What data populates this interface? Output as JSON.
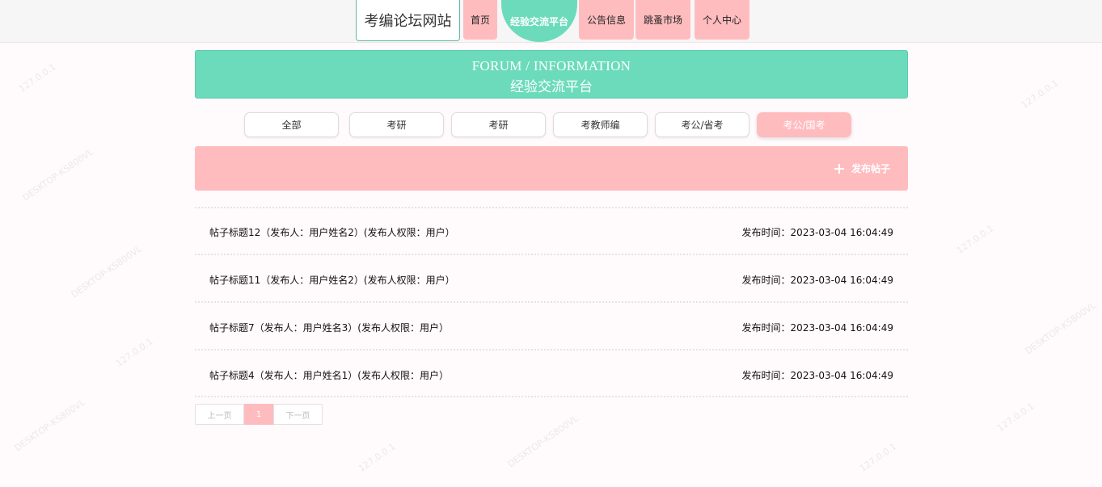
{
  "site": {
    "brand": "考编论坛网站"
  },
  "nav": [
    {
      "label": "首页",
      "active": false
    },
    {
      "label": "经验交流平台",
      "active": true
    },
    {
      "label": "公告信息",
      "active": false
    },
    {
      "label": "跳蚤市场",
      "active": false
    },
    {
      "label": "个人中心",
      "active": false
    }
  ],
  "banner": {
    "en": "FORUM / INFORMATION",
    "zh": "经验交流平台"
  },
  "categories": [
    {
      "label": "全部",
      "active": false
    },
    {
      "label": "考研",
      "active": false
    },
    {
      "label": "考研",
      "active": false
    },
    {
      "label": "考教师编",
      "active": false
    },
    {
      "label": "考公/省考",
      "active": false
    },
    {
      "label": "考公/国考",
      "active": true
    }
  ],
  "publish": {
    "label": "发布帖子",
    "icon": "plus-icon"
  },
  "posts": [
    {
      "title": "帖子标题12（发布人：用户姓名2）(发布人权限：用户）",
      "time": "发布时间：2023-03-04 16:04:49"
    },
    {
      "title": "帖子标题11（发布人：用户姓名2）(发布人权限：用户）",
      "time": "发布时间：2023-03-04 16:04:49"
    },
    {
      "title": "帖子标题7（发布人：用户姓名3）(发布人权限：用户）",
      "time": "发布时间：2023-03-04 16:04:49"
    },
    {
      "title": "帖子标题4（发布人：用户姓名1）(发布人权限：用户）",
      "time": "发布时间：2023-03-04 16:04:49"
    }
  ],
  "pagination": {
    "prev": "上一页",
    "current": "1",
    "next": "下一页"
  },
  "watermark": [
    "127.0.0.1",
    "DESKTOP-KS800VL"
  ],
  "colors": {
    "accent_green": "#6cdbbb",
    "accent_pink": "#ffbcbf"
  }
}
